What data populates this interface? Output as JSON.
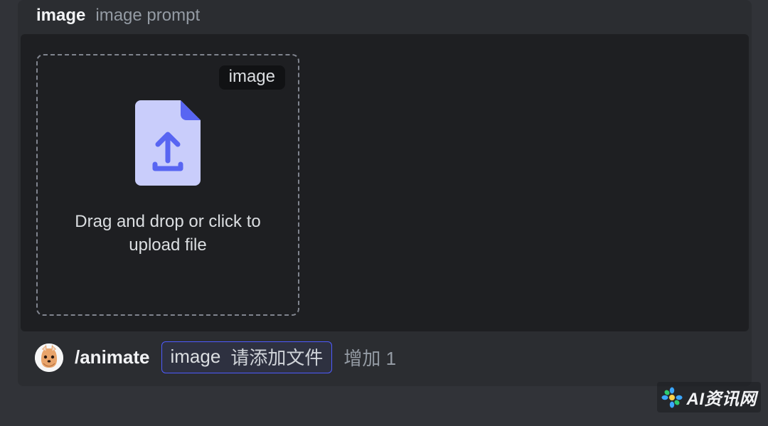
{
  "panel": {
    "header_title": "image",
    "header_subtitle": "image prompt"
  },
  "dropzone": {
    "badge": "image",
    "hint": "Drag and drop or click to upload file"
  },
  "composer": {
    "command": "/animate",
    "param_name": "image",
    "param_value": "请添加文件",
    "add_more": "增加 1"
  },
  "watermark": {
    "text": "AI资讯网"
  }
}
